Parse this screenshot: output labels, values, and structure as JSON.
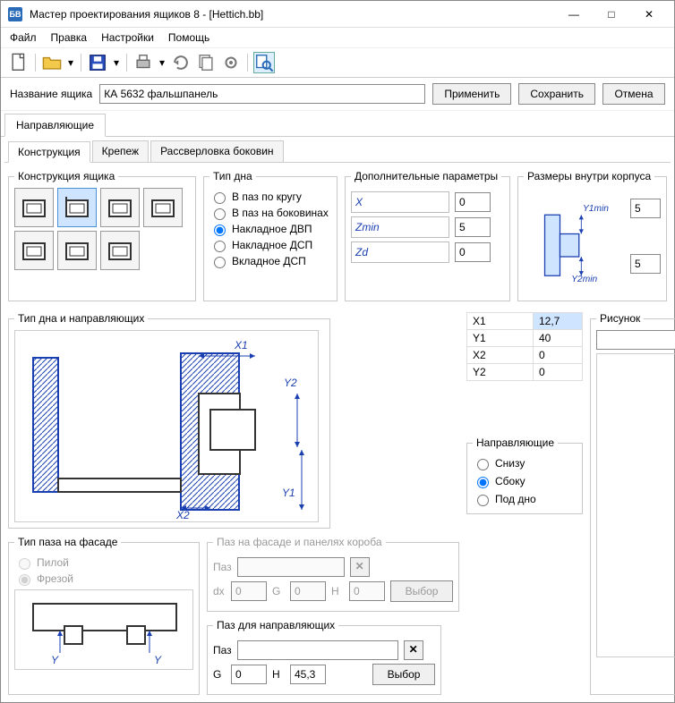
{
  "window": {
    "title": "Мастер проектирования ящиков 8 - [Hettich.bb]",
    "app_badge": "БВ"
  },
  "menu": {
    "file": "Файл",
    "edit": "Правка",
    "settings": "Настройки",
    "help": "Помощь"
  },
  "name_row": {
    "label": "Название ящика",
    "value": "КА 5632 фальшпанель",
    "apply": "Применить",
    "save": "Сохранить",
    "cancel": "Отмена"
  },
  "outer_tabs": {
    "guides": "Направляющие"
  },
  "inner_tabs": {
    "construction": "Конструкция",
    "fasteners": "Крепеж",
    "drilling": "Рассверловка боковин"
  },
  "group": {
    "box_construction": "Конструкция ящика",
    "bottom_type": "Тип дна",
    "extra_params": "Дополнительные параметры",
    "inner_dims": "Размеры внутри корпуса",
    "bottom_and_guides": "Тип дна и направляющих",
    "picture": "Рисунок",
    "guides_pos": "Направляющие",
    "facade_groove_type": "Тип паза на фасаде",
    "groove_facade_panels": "Паз на фасаде и панелях короба",
    "groove_guides": "Паз для направляющих"
  },
  "bottom_types": {
    "around": "В паз по кругу",
    "sides": "В паз на боковинах",
    "overlay_dvp": "Накладное ДВП",
    "overlay_dsp": "Накладное ДСП",
    "inset_dsp": "Вкладное ДСП"
  },
  "params": {
    "x_label": "X",
    "x_val": "0",
    "zmin_label": "Zmin",
    "zmin_val": "5",
    "zd_label": "Zd",
    "zd_val": "0"
  },
  "inner_dims": {
    "y1min_label": "Y1min",
    "y1min_val": "5",
    "y2min_label": "Y2min",
    "y2min_val": "5"
  },
  "coord_table": {
    "x1": "X1",
    "x1v": "12,7",
    "y1": "Y1",
    "y1v": "40",
    "x2": "X2",
    "x2v": "0",
    "y2": "Y2",
    "y2v": "0"
  },
  "guide_pos": {
    "bottom": "Снизу",
    "side": "Сбоку",
    "under": "Под дно"
  },
  "facade_groove": {
    "saw": "Пилой",
    "mill": "Фрезой"
  },
  "groove1": {
    "label": "Паз",
    "value": "",
    "dx": "dx",
    "dxv": "0",
    "g": "G",
    "gv": "0",
    "h": "H",
    "hv": "0",
    "choose": "Выбор"
  },
  "groove2": {
    "label": "Паз",
    "value": "",
    "g": "G",
    "gv": "0",
    "h": "H",
    "hv": "45,3",
    "choose": "Выбор"
  },
  "fig": {
    "x1": "X1",
    "x2": "X2",
    "y1": "Y1",
    "y2": "Y2",
    "y": "Y"
  }
}
